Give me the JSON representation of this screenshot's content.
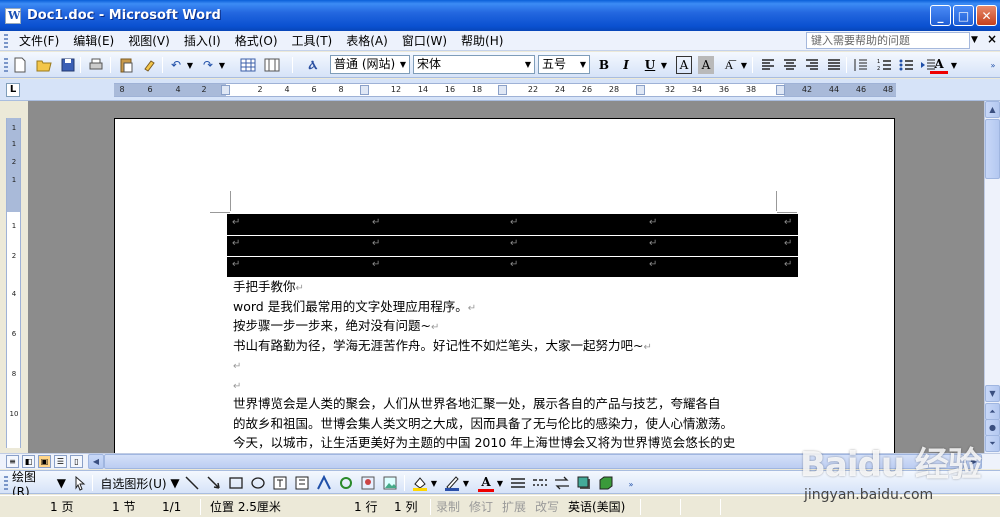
{
  "window": {
    "title": "Doc1.doc - Microsoft Word",
    "minimize": "_",
    "maximize": "□",
    "close": "✕"
  },
  "menu": {
    "items": [
      "文件(F)",
      "编辑(E)",
      "视图(V)",
      "插入(I)",
      "格式(O)",
      "工具(T)",
      "表格(A)",
      "窗口(W)",
      "帮助(H)"
    ],
    "help_placeholder": "键入需要帮助的问题",
    "doc_close": "×"
  },
  "toolbar": {
    "style_value": "普通 (网站)",
    "font_value": "宋体",
    "size_value": "五号",
    "bold": "B",
    "italic": "I",
    "underline": "U",
    "char_border": "A",
    "char_shading": "A",
    "font_color": "A"
  },
  "ruler": {
    "corner": "L",
    "ticks": [
      "8",
      "6",
      "4",
      "2",
      "2",
      "4",
      "6",
      "8",
      "12",
      "14",
      "16",
      "18",
      "22",
      "24",
      "26",
      "28",
      "32",
      "34",
      "36",
      "38",
      "42",
      "44",
      "46",
      "48"
    ],
    "vticks": [
      "1",
      "1",
      "2",
      "1",
      "1",
      "2",
      "4",
      "6",
      "8",
      "10"
    ]
  },
  "document": {
    "lines": [
      "手把手教你",
      "word 是我们最常用的文字处理应用程序。",
      "按步骤一步一步来，绝对没有问题~",
      "书山有路勤为径，学海无涯苦作舟。好记性不如烂笔头，大家一起努力吧~",
      "",
      "",
      "世界博览会是人类的聚会，人们从世界各地汇聚一处，展示各自的产品与技艺，夸耀各自",
      "的故乡和祖国。世博会集人类文明之大成，因而具备了无与伦比的感染力，使人心情激荡。",
      "今天，以城市，让生活更美好为主题的中国 2010 年上海世博会又将为世界博览会悠长的史"
    ],
    "para_mark": "↵",
    "cell_mark": "↵"
  },
  "drawbar": {
    "draw_label": "绘图(R)",
    "autoshape_label": "自选图形(U)"
  },
  "status": {
    "page": "1 页",
    "section": "1 节",
    "page_of": "1/1",
    "position": "位置 2.5厘米",
    "line": "1 行",
    "column": "1 列",
    "rec": "录制",
    "trk": "修订",
    "ext": "扩展",
    "ovr": "改写",
    "language": "英语(美国)"
  },
  "watermark": {
    "brand": "Baidu 经验",
    "url": "jingyan.baidu.com"
  }
}
